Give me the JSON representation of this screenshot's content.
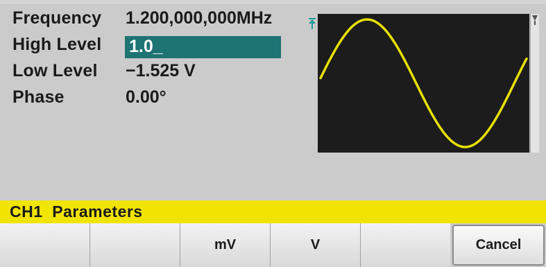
{
  "parameters": [
    {
      "label": "Frequency",
      "value": "1.200,000,000MHz"
    },
    {
      "label": "High Level",
      "value": "1.0_"
    },
    {
      "label": "Low Level",
      "value": "−1.525 V"
    },
    {
      "label": "Phase",
      "value": "0.00°"
    }
  ],
  "status_bar": {
    "text": "CH1  Parameters"
  },
  "softkeys": [
    "",
    "",
    "mV",
    "V",
    "",
    "Cancel"
  ],
  "colors": {
    "status_bar": "#f0e400",
    "edit_highlight": "#1e7373",
    "waveform": "#e8e000",
    "display_bg": "#1c1c1c"
  },
  "waveform": {
    "type": "sine",
    "cycles": 1
  }
}
